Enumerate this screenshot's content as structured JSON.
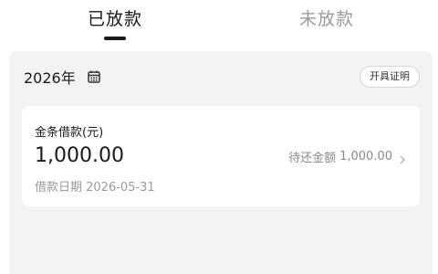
{
  "tabs": [
    {
      "label": "已放款",
      "active": true
    },
    {
      "label": "未放款",
      "active": false
    }
  ],
  "year": {
    "label": "2026年",
    "icon": "calendar-icon"
  },
  "certificate_button": {
    "label": "开具证明"
  },
  "loan": {
    "title": "金条借款(元)",
    "amount": "1,000.00",
    "date": "借款日期 2026-05-31",
    "due_label": "待还金额",
    "due_value": "1,000.00",
    "icon": "chevron-right-icon"
  },
  "colors": {
    "panel_bg": "#f3f3f6",
    "text_primary": "#1a1a1a",
    "text_secondary": "#9a9a9a"
  }
}
